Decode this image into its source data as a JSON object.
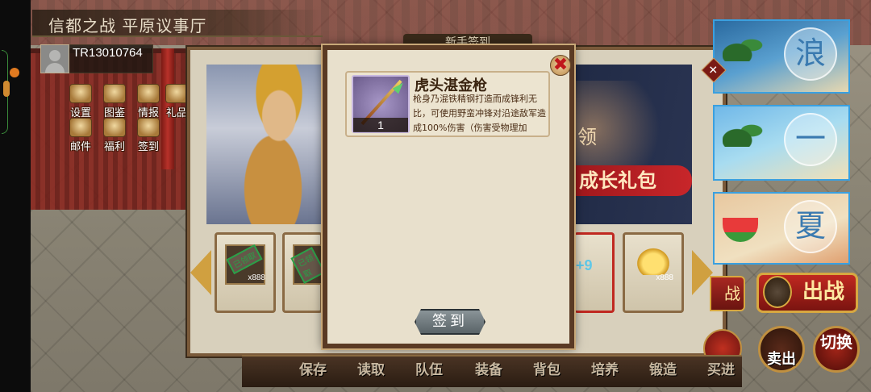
{
  "location": "信都之战 平原议事厅",
  "player": {
    "id": "TR13010764"
  },
  "menu": [
    {
      "label": "设置"
    },
    {
      "label": "图鉴"
    },
    {
      "label": "情报"
    },
    {
      "label": "礼品"
    },
    {
      "label": "邮件"
    },
    {
      "label": "福利"
    },
    {
      "label": "签到"
    }
  ],
  "signin_panel": {
    "title": "新手签到",
    "banner": {
      "text_ling": "领",
      "text_pack": "成长礼包"
    },
    "rewards": [
      {
        "count": "x888",
        "status": "已领取"
      },
      {
        "count": "",
        "status": "已领取"
      },
      {
        "count": "+9",
        "status": ""
      },
      {
        "count": "x888",
        "status": ""
      }
    ]
  },
  "item_detail": {
    "name": "虎头湛金枪",
    "count": "1",
    "description": "枪身乃混铁精钢打造而成锋利无比，可使用野蛮冲锋对沿途敌军造成100%伤害（伤害受物理加",
    "button": "签到",
    "close_symbol": "✖"
  },
  "promos": [
    {
      "char": "浪"
    },
    {
      "char": "一"
    },
    {
      "char": "夏"
    }
  ],
  "actions": {
    "battle": "出战",
    "battle_partial": "战",
    "sell": "卖出",
    "switch": "切换"
  },
  "bottom_nav": [
    "保存",
    "读取",
    "队伍",
    "装备",
    "背包",
    "培养",
    "锻造",
    "买进"
  ],
  "colors": {
    "accent": "#c02820",
    "panel": "#d8d0bc",
    "frame": "#5a3a24"
  }
}
